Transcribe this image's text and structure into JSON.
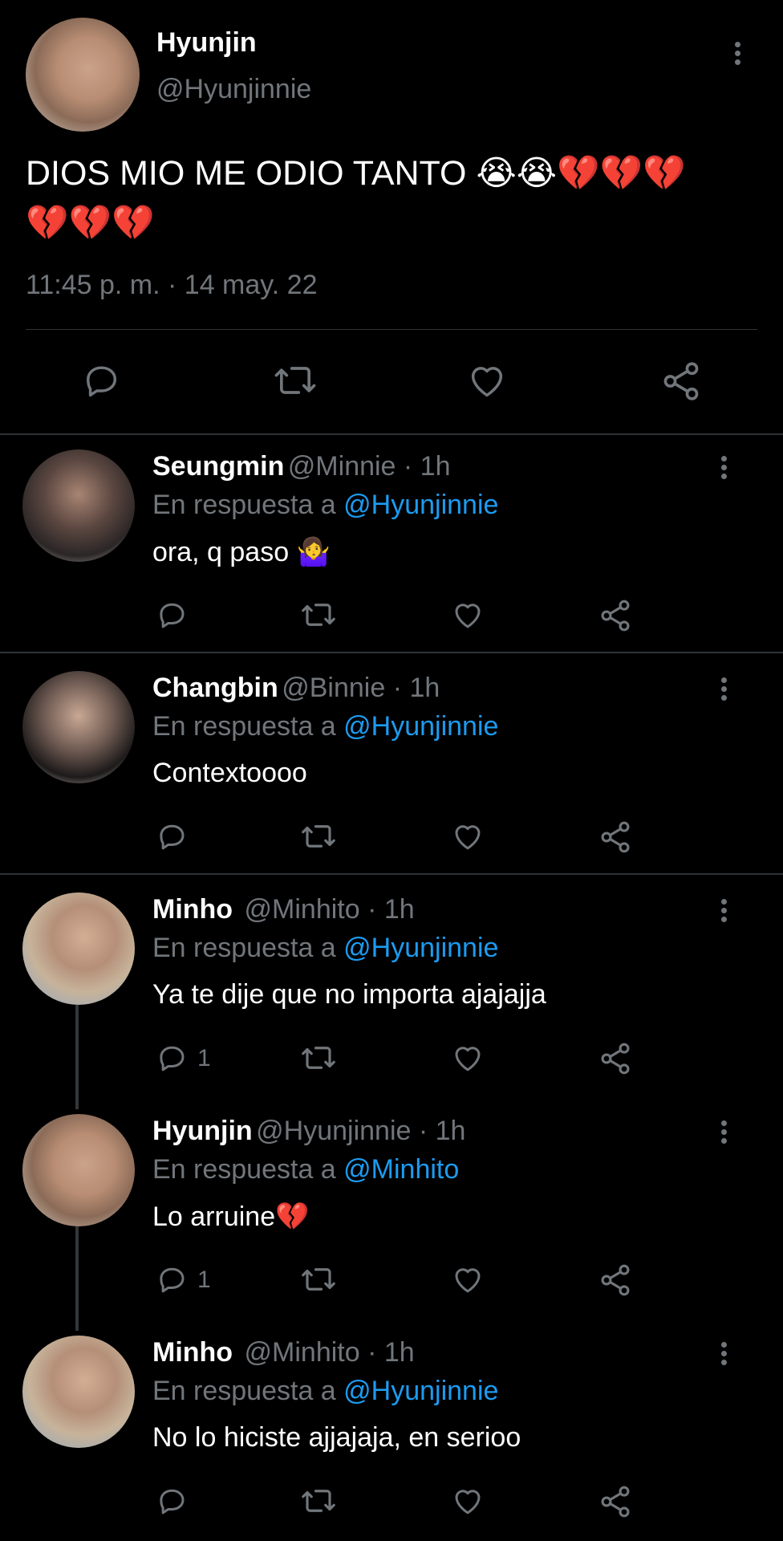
{
  "main_tweet": {
    "name": "Hyunjin",
    "handle": "@Hyunjinnie",
    "text_line1": "DIOS MIO ME ODIO TANTO",
    "emoji_line1": "😭😭💔💔💔",
    "emoji_line2": "💔💔💔",
    "timestamp": "11:45 p. m. · 14 may. 22",
    "icons": [
      "reply-icon",
      "retweet-icon",
      "like-icon",
      "share-icon"
    ]
  },
  "replies": [
    {
      "name": "Seungmin",
      "handle": "@Minnie · 1h",
      "in_reply_prefix": "En respuesta a",
      "in_reply_to": "@Hyunjinnie",
      "text": "ora, q paso",
      "text_emoji": "🤷‍♀️",
      "reply_count": ""
    },
    {
      "name": "Changbin",
      "handle": "@Binnie · 1h",
      "in_reply_prefix": "En respuesta a",
      "in_reply_to": "@Hyunjinnie",
      "text": "Contextoooo",
      "text_emoji": "",
      "reply_count": ""
    },
    {
      "name": "Minho",
      "handle": "@Minhito · 1h",
      "in_reply_prefix": "En respuesta a",
      "in_reply_to": "@Hyunjinnie",
      "text": "Ya te dije que no importa ajajajja",
      "text_emoji": "",
      "reply_count": "1"
    },
    {
      "name": "Hyunjin",
      "handle": "@Hyunjinnie · 1h",
      "in_reply_prefix": "En respuesta a",
      "in_reply_to": "@Minhito",
      "text": "Lo arruine",
      "text_emoji": "💔",
      "reply_count": "1"
    },
    {
      "name": "Minho",
      "handle": "@Minhito · 1h",
      "in_reply_prefix": "En respuesta a",
      "in_reply_to": "@Hyunjinnie",
      "text": "No lo hiciste ajjajaja, en serioo",
      "text_emoji": "",
      "reply_count": ""
    }
  ],
  "colors": {
    "background": "#000000",
    "text": "#ffffff",
    "muted": "#71767b",
    "mention": "#1d9bf0",
    "divider": "#2f3336"
  }
}
